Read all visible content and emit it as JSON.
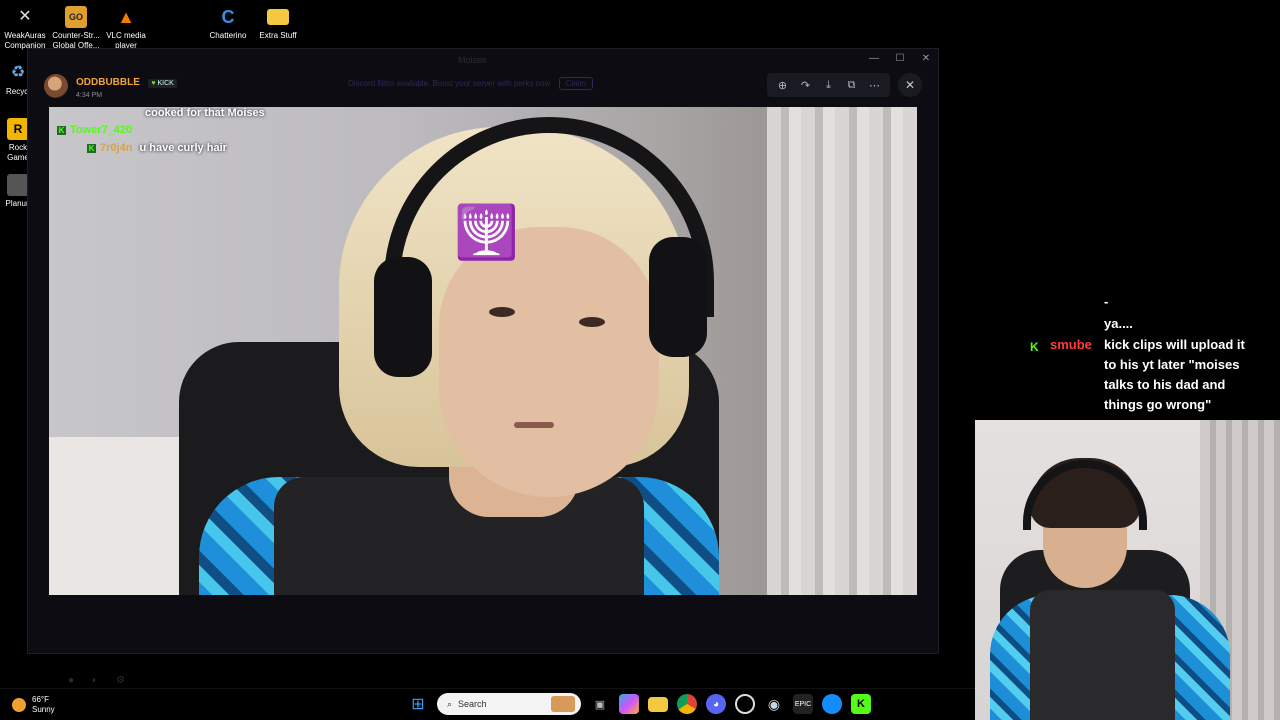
{
  "desktop": {
    "icons": [
      {
        "label": "WeakAuras\nCompanion",
        "icon": "weakauras-icon",
        "color": "#cccccc"
      },
      {
        "label": "Counter-Str...\nGlobal Offe...",
        "icon": "csgo-icon",
        "color": "#e0a030"
      },
      {
        "label": "VLC media\nplayer",
        "icon": "vlc-icon",
        "color": "#f07c00"
      },
      {
        "label": "Chatterino",
        "icon": "chatterino-icon",
        "color": "#3a8ee6"
      },
      {
        "label": "Extra Stuff",
        "icon": "folder-icon",
        "color": "#f5c842"
      },
      {
        "label": "Recycl",
        "icon": "recycle-bin-icon",
        "color": "#6aa8e0"
      },
      {
        "label": "Rock\nGame",
        "icon": "rockstar-icon",
        "color": "#f2b600"
      },
      {
        "label": "Planun",
        "icon": "app-icon",
        "color": "#888888"
      }
    ]
  },
  "window": {
    "title": "Moises",
    "notice": "Discord Nitro available. Boost your server with perks now",
    "notice_button": "Claim"
  },
  "post": {
    "author": "ODDBUBBLE",
    "badge": "KICK",
    "time": "4:34 PM"
  },
  "toolbar": [
    "zoom-in-icon",
    "forward-icon",
    "download-icon",
    "open-external-icon",
    "more-icon"
  ],
  "video_chat": [
    {
      "user": "",
      "message": "cooked for that Moises",
      "user_color": "#ffffff"
    },
    {
      "user": "Tower7_420",
      "message": "",
      "user_color": "#53fc18"
    },
    {
      "user": "7r0j4n",
      "message": "u have curly hair",
      "user_color": "#d9a441"
    }
  ],
  "side_chat": {
    "line_top": "-",
    "line_prev": "ya....",
    "user": "smube",
    "message_lines": [
      "kick clips will upload it",
      "to his yt later \"moises",
      "talks to his dad and",
      "things go wrong\""
    ]
  },
  "taskbar": {
    "weather_temp": "66°F",
    "weather_desc": "Sunny",
    "search_placeholder": "Search"
  }
}
